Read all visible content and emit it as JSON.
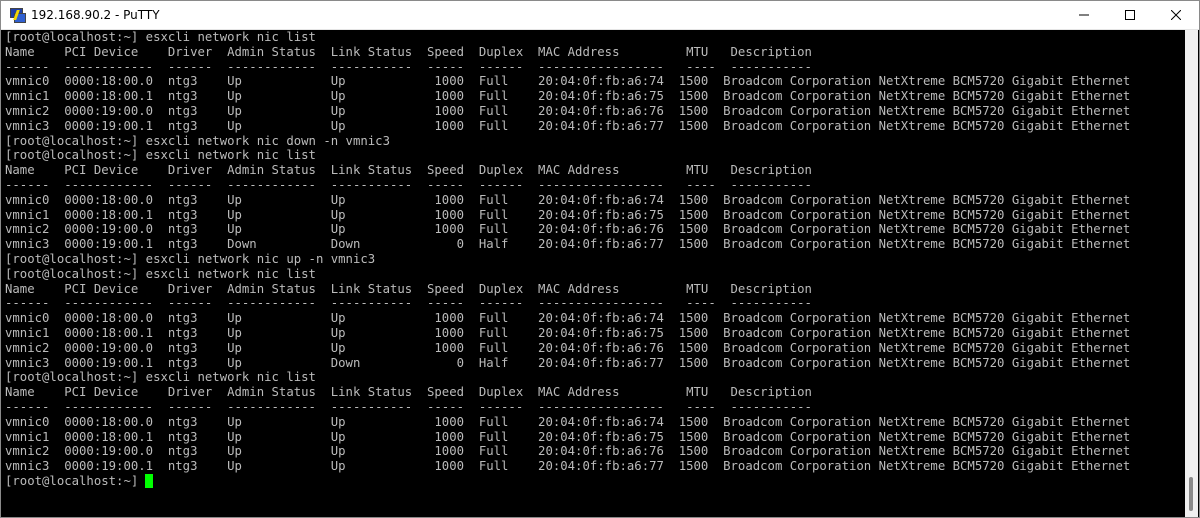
{
  "window": {
    "title": "192.168.90.2 - PuTTY",
    "icon": "putty-icon",
    "controls": [
      "minimize-icon",
      "maximize-icon",
      "close-icon"
    ]
  },
  "terminal": {
    "lines": [
      "[root@localhost:~] esxcli network nic list",
      "Name    PCI Device    Driver  Admin Status  Link Status  Speed  Duplex  MAC Address         MTU   Description",
      "------  ------------  ------  ------------  -----------  -----  ------  -----------------   ----  -----------",
      "vmnic0  0000:18:00.0  ntg3    Up            Up            1000  Full    20:04:0f:fb:a6:74  1500  Broadcom Corporation NetXtreme BCM5720 Gigabit Ethernet",
      "vmnic1  0000:18:00.1  ntg3    Up            Up            1000  Full    20:04:0f:fb:a6:75  1500  Broadcom Corporation NetXtreme BCM5720 Gigabit Ethernet",
      "vmnic2  0000:19:00.0  ntg3    Up            Up            1000  Full    20:04:0f:fb:a6:76  1500  Broadcom Corporation NetXtreme BCM5720 Gigabit Ethernet",
      "vmnic3  0000:19:00.1  ntg3    Up            Up            1000  Full    20:04:0f:fb:a6:77  1500  Broadcom Corporation NetXtreme BCM5720 Gigabit Ethernet",
      "[root@localhost:~] esxcli network nic down -n vmnic3",
      "[root@localhost:~] esxcli network nic list",
      "Name    PCI Device    Driver  Admin Status  Link Status  Speed  Duplex  MAC Address         MTU   Description",
      "------  ------------  ------  ------------  -----------  -----  ------  -----------------   ----  -----------",
      "vmnic0  0000:18:00.0  ntg3    Up            Up            1000  Full    20:04:0f:fb:a6:74  1500  Broadcom Corporation NetXtreme BCM5720 Gigabit Ethernet",
      "vmnic1  0000:18:00.1  ntg3    Up            Up            1000  Full    20:04:0f:fb:a6:75  1500  Broadcom Corporation NetXtreme BCM5720 Gigabit Ethernet",
      "vmnic2  0000:19:00.0  ntg3    Up            Up            1000  Full    20:04:0f:fb:a6:76  1500  Broadcom Corporation NetXtreme BCM5720 Gigabit Ethernet",
      "vmnic3  0000:19:00.1  ntg3    Down          Down             0  Half    20:04:0f:fb:a6:77  1500  Broadcom Corporation NetXtreme BCM5720 Gigabit Ethernet",
      "[root@localhost:~] esxcli network nic up -n vmnic3",
      "[root@localhost:~] esxcli network nic list",
      "Name    PCI Device    Driver  Admin Status  Link Status  Speed  Duplex  MAC Address         MTU   Description",
      "------  ------------  ------  ------------  -----------  -----  ------  -----------------   ----  -----------",
      "vmnic0  0000:18:00.0  ntg3    Up            Up            1000  Full    20:04:0f:fb:a6:74  1500  Broadcom Corporation NetXtreme BCM5720 Gigabit Ethernet",
      "vmnic1  0000:18:00.1  ntg3    Up            Up            1000  Full    20:04:0f:fb:a6:75  1500  Broadcom Corporation NetXtreme BCM5720 Gigabit Ethernet",
      "vmnic2  0000:19:00.0  ntg3    Up            Up            1000  Full    20:04:0f:fb:a6:76  1500  Broadcom Corporation NetXtreme BCM5720 Gigabit Ethernet",
      "vmnic3  0000:19:00.1  ntg3    Up            Down             0  Half    20:04:0f:fb:a6:77  1500  Broadcom Corporation NetXtreme BCM5720 Gigabit Ethernet",
      "[root@localhost:~] esxcli network nic list",
      "Name    PCI Device    Driver  Admin Status  Link Status  Speed  Duplex  MAC Address         MTU   Description",
      "------  ------------  ------  ------------  -----------  -----  ------  -----------------   ----  -----------",
      "vmnic0  0000:18:00.0  ntg3    Up            Up            1000  Full    20:04:0f:fb:a6:74  1500  Broadcom Corporation NetXtreme BCM5720 Gigabit Ethernet",
      "vmnic1  0000:18:00.1  ntg3    Up            Up            1000  Full    20:04:0f:fb:a6:75  1500  Broadcom Corporation NetXtreme BCM5720 Gigabit Ethernet",
      "vmnic2  0000:19:00.0  ntg3    Up            Up            1000  Full    20:04:0f:fb:a6:76  1500  Broadcom Corporation NetXtreme BCM5720 Gigabit Ethernet",
      "vmnic3  0000:19:00.1  ntg3    Up            Up            1000  Full    20:04:0f:fb:a6:77  1500  Broadcom Corporation NetXtreme BCM5720 Gigabit Ethernet"
    ],
    "prompt": "[root@localhost:~]",
    "colors": {
      "background": "#000000",
      "foreground": "#bbbbbb",
      "cursor": "#00ff00"
    }
  }
}
